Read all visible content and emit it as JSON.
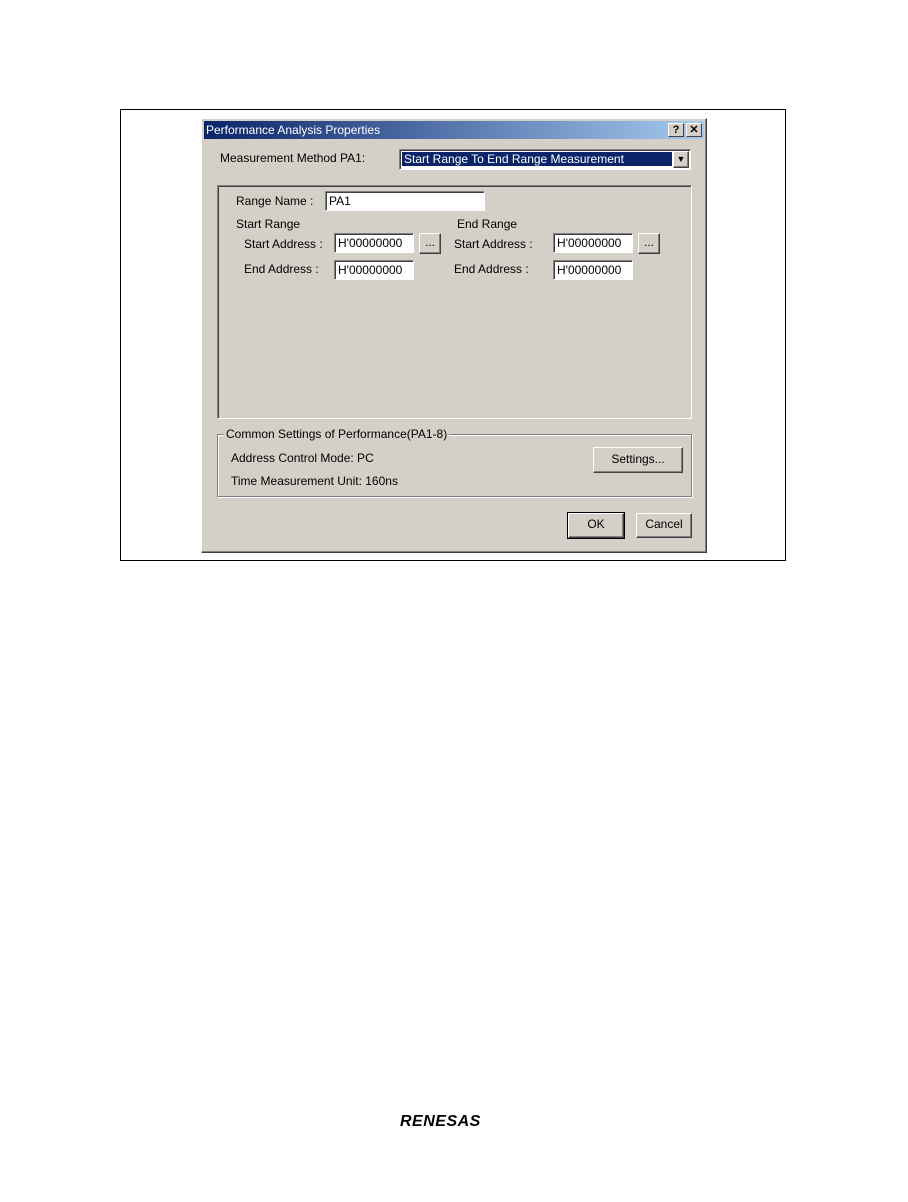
{
  "dialog": {
    "title": "Performance Analysis Properties",
    "help_glyph": "?",
    "close_glyph": "✕"
  },
  "measurement": {
    "label": "Measurement Method PA1:",
    "selected": "Start Range To End Range Measurement",
    "arrow_glyph": "▼"
  },
  "range": {
    "name_label": "Range Name :",
    "name_value": "PA1",
    "start_heading": "Start Range",
    "end_heading": "End Range",
    "start_address_label": "Start Address :",
    "end_address_label": "End Address :",
    "start_range_start_address": "H'00000000",
    "start_range_end_address": "H'00000000",
    "end_range_start_address": "H'00000000",
    "end_range_end_address": "H'00000000",
    "browse_label": "..."
  },
  "common": {
    "group_label": "Common Settings of Performance(PA1-8)",
    "address_control_mode": "Address Control Mode: PC",
    "time_unit": "Time Measurement Unit: 160ns",
    "settings_label": "Settings..."
  },
  "footer": {
    "ok_label": "OK",
    "cancel_label": "Cancel"
  },
  "logo_text": "RENESAS"
}
